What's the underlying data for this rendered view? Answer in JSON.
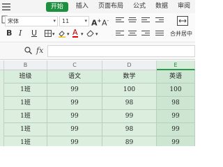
{
  "ribbon": {
    "tabs": [
      {
        "label": "开始",
        "active": true
      },
      {
        "label": "插入",
        "active": false
      },
      {
        "label": "页面布局",
        "active": false
      },
      {
        "label": "公式",
        "active": false
      },
      {
        "label": "数据",
        "active": false
      },
      {
        "label": "审阅",
        "active": false
      }
    ],
    "accent_color": "#1e8f3e"
  },
  "toolbar": {
    "font_name": "宋体",
    "font_size": "11",
    "bold": "B",
    "italic": "I",
    "underline": "U",
    "merge_label": "合并居中"
  },
  "formula_bar": {
    "fx_label": "fx",
    "zoom_icon": "magnifier-icon",
    "value": ""
  },
  "grid": {
    "columns": [
      "B",
      "C",
      "D",
      "E"
    ],
    "selected_column": "E",
    "header_row": [
      "班级",
      "语文",
      "数学",
      "英语"
    ],
    "rows": [
      [
        "1班",
        "99",
        "100",
        "100"
      ],
      [
        "1班",
        "99",
        "98",
        "98"
      ],
      [
        "1班",
        "99",
        "99",
        "99"
      ],
      [
        "1班",
        "99",
        "98",
        "99"
      ],
      [
        "1班",
        "99",
        "89",
        "99"
      ]
    ],
    "highlight_color": "#dcefdf"
  }
}
